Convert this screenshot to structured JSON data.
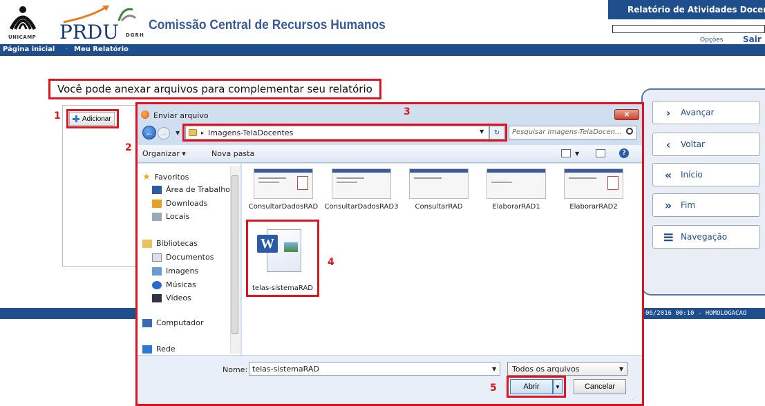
{
  "header": {
    "unicamp_logo_text": "UNICAMP",
    "prdu_text": "PRDU",
    "dgrh_text": "DGRH",
    "org_title": "Comissão Central de Recursos Humanos",
    "app_title": "Relatório de Atividades Docente",
    "options_link": "Opções",
    "logout_link": "Sair"
  },
  "nav": {
    "home": "Página inicial",
    "separator": "·",
    "my_report": "Meu Relatório"
  },
  "main": {
    "instruction": "Você pode anexar arquivos para complementar seu relatório",
    "add_button": "Adicionar",
    "step_labels": [
      "1",
      "2",
      "3",
      "4",
      "5"
    ]
  },
  "right_nav": {
    "items": [
      {
        "icon": "chevron-right",
        "glyph": "›",
        "label": "Avançar"
      },
      {
        "icon": "chevron-left",
        "glyph": "‹",
        "label": "Voltar"
      },
      {
        "icon": "double-chevron-left",
        "glyph": "«",
        "label": "Início"
      },
      {
        "icon": "double-chevron-right",
        "glyph": "»",
        "label": "Fim"
      },
      {
        "icon": "menu",
        "glyph": "≡",
        "label": "Navegação"
      }
    ]
  },
  "footer": {
    "status_text": "06/2016 00:10 - HOMOLOGACAO"
  },
  "dialog": {
    "title": "Enviar arquivo",
    "close_glyph": "✕",
    "address_path": "Imagens-TelaDocentes",
    "search_placeholder": "Pesquisar Imagens-TelaDocen...",
    "toolbar": {
      "organize": "Organizar ▾",
      "new_folder": "Nova pasta",
      "help": "?"
    },
    "nav_pane": {
      "favorites": "Favoritos",
      "items_fav": [
        "Área de Trabalho",
        "Downloads",
        "Locais"
      ],
      "libraries": "Bibliotecas",
      "items_lib": [
        "Documentos",
        "Imagens",
        "Músicas",
        "Vídeos"
      ],
      "computer": "Computador",
      "network": "Rede"
    },
    "files": [
      {
        "name": "ConsultarDadosRAD"
      },
      {
        "name": "ConsultarDadosRAD3"
      },
      {
        "name": "ConsultarRAD"
      },
      {
        "name": "ElaborarRAD1"
      },
      {
        "name": "ElaborarRAD2"
      }
    ],
    "selected_file": "telas-sistemaRAD",
    "word_badge": "W",
    "name_label": "Nome:",
    "name_value": "telas-sistemaRAD",
    "filter_value": "Todos os arquivos",
    "open_button": "Abrir",
    "cancel_button": "Cancelar"
  },
  "colors": {
    "brand_blue": "#1f4e8c",
    "highlight_red": "#e0141e"
  }
}
